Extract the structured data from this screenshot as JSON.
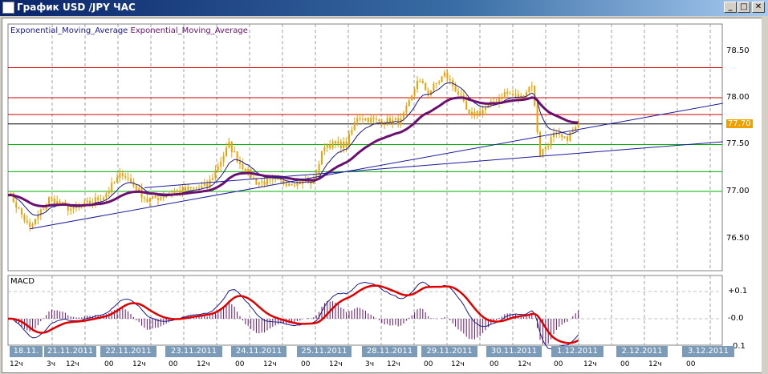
{
  "window": {
    "title": "График USD /JPY  ЧАС",
    "minimize": "_",
    "maximize": "□",
    "close": "✕",
    "icon": "chart-icon"
  },
  "legend": {
    "ema1": "Exponential_Moving_Average",
    "ema2": "Exponential_Moving_Average"
  },
  "price_axis": [
    "78.50",
    "78.00",
    "77.50",
    "77.00",
    "76.50"
  ],
  "current_price": "77.70",
  "macd": {
    "label": "MACD",
    "axis": [
      "+0.1",
      "-0.0",
      "0.1"
    ]
  },
  "dates": [
    "18.11.",
    "21.11.2011",
    "22.11.2011",
    "23.11.2011",
    "24.11.2011",
    "25.11.2011",
    "28.11.2011",
    "29.11.2011",
    "30.11.2011",
    "1.12.2011",
    "2.12.2011",
    "3.12.2011"
  ],
  "hours": [
    "12ч",
    "3ч",
    "12ч",
    "00",
    "12ч",
    "00",
    "12ч",
    "00",
    "12ч",
    "00",
    "12ч",
    "3ч",
    "12ч",
    "00",
    "12ч",
    "00",
    "12ч",
    "00",
    "12ч",
    "00",
    "12ч",
    "00"
  ],
  "colors": {
    "candle": "#f0a000",
    "ema_fast": "#1a1a8c",
    "ema_slow": "#6b1070",
    "resistance": "#d00000",
    "support": "#00b000",
    "trend": "#1a1a9c",
    "macd_signal": "#e00000"
  },
  "chart_data": {
    "type": "candlestick",
    "symbol": "USD/JPY",
    "timeframe": "H1",
    "ylim": [
      76.2,
      78.75
    ],
    "price_path": [
      [
        0,
        77.0
      ],
      [
        8,
        76.6
      ],
      [
        15,
        76.92
      ],
      [
        24,
        76.8
      ],
      [
        35,
        76.95
      ],
      [
        42,
        77.2
      ],
      [
        51,
        76.9
      ],
      [
        62,
        77.0
      ],
      [
        73,
        77.05
      ],
      [
        81,
        77.5
      ],
      [
        85,
        77.3
      ],
      [
        91,
        77.1
      ],
      [
        103,
        77.1
      ],
      [
        112,
        77.1
      ],
      [
        116,
        77.5
      ],
      [
        124,
        77.5
      ],
      [
        128,
        77.8
      ],
      [
        135,
        77.75
      ],
      [
        144,
        77.75
      ],
      [
        148,
        78.0
      ],
      [
        150,
        78.2
      ],
      [
        154,
        78.05
      ],
      [
        160,
        78.25
      ],
      [
        165,
        78.05
      ],
      [
        169,
        77.8
      ],
      [
        176,
        77.9
      ],
      [
        182,
        78.05
      ],
      [
        188,
        78.0
      ],
      [
        192,
        78.15
      ],
      [
        195,
        77.4
      ],
      [
        200,
        77.6
      ],
      [
        204,
        77.55
      ],
      [
        209,
        77.7
      ]
    ],
    "horizontal_levels": {
      "resistance": [
        78.32,
        78.0,
        77.82
      ],
      "current": 77.72,
      "support": [
        77.5,
        77.21,
        77.0
      ]
    },
    "trendlines": [
      [
        [
          76.6,
          8
        ],
        [
          77.94,
          262
        ]
      ],
      [
        [
          77.04,
          50
        ],
        [
          77.53,
          262
        ]
      ]
    ],
    "macd_ylim": [
      -0.1,
      0.16
    ]
  }
}
